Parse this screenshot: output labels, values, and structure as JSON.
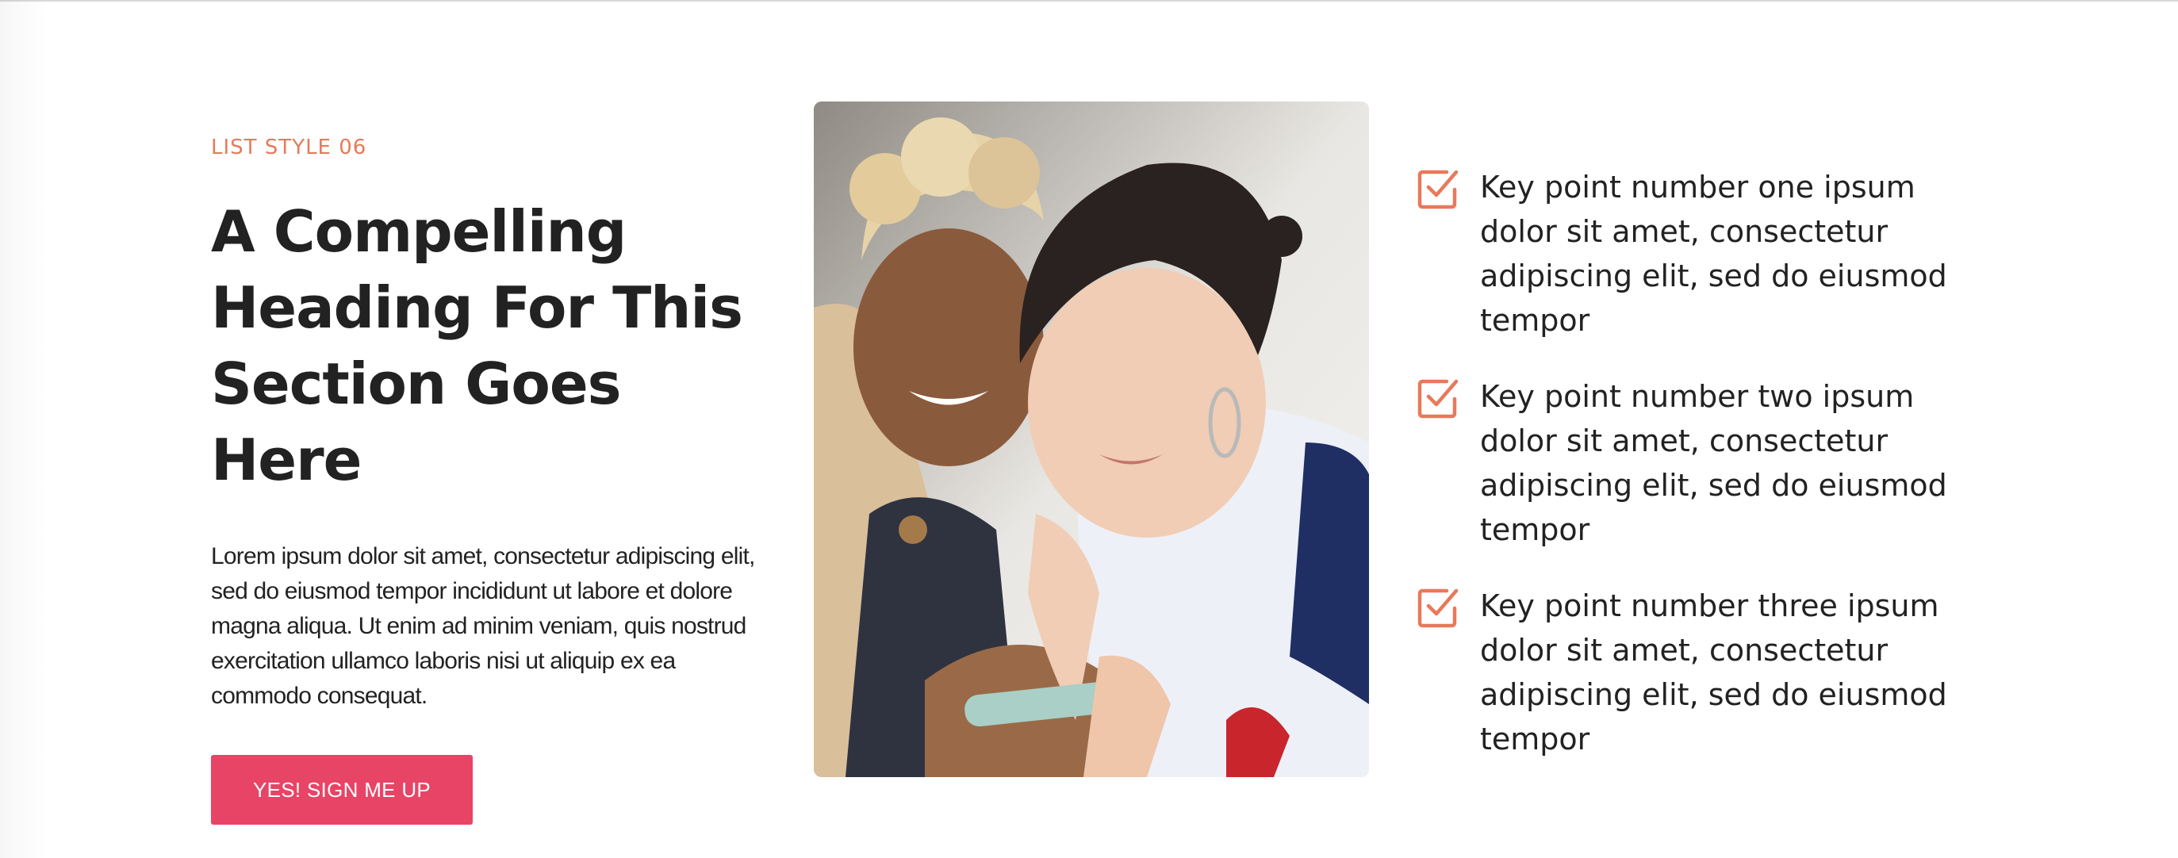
{
  "section": {
    "eyebrow": "LIST STYLE 06",
    "heading": "A Compelling Heading For This Section Goes Here",
    "body": "Lorem ipsum dolor sit amet, consectetur adipiscing elit, sed do eiusmod tempor incididunt ut labore et dolore magna aliqua. Ut enim ad minim veniam, quis nostrud exercitation ullamco laboris nisi ut aliquip ex ea commodo consequat.",
    "cta_label": "YES! SIGN ME UP"
  },
  "list": {
    "icon": "checkbox-checked-icon",
    "items": [
      {
        "text": "Key point number one ipsum dolor sit amet, consectetur adipiscing elit, sed do eiusmod tempor"
      },
      {
        "text": "Key point number two ipsum dolor sit amet, consectetur adipiscing elit, sed do eiusmod tempor"
      },
      {
        "text": "Key point number three ipsum dolor sit amet, consectetur adipiscing elit, sed do eiusmod tempor"
      }
    ]
  },
  "colors": {
    "accent": "#e8795a",
    "button": "#e84466",
    "text": "#222222",
    "background": "#ffffff"
  }
}
